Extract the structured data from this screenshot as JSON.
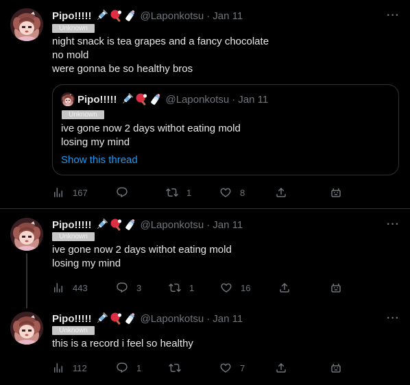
{
  "author": {
    "name": "Pipo!!!!!",
    "handle": "@Laponkotsu",
    "separator": "·",
    "badge": "Unknown",
    "emoji_names": [
      "syringe-emoji",
      "ping-pong-emoji",
      "baby-bottle-emoji"
    ]
  },
  "tweets": [
    {
      "date": "Jan 11",
      "lines": [
        "night snack is tea grapes and a fancy chocolate",
        "no mold",
        "were gonna be so healthy bros"
      ],
      "quote": {
        "name": "Pipo!!!!!",
        "handle": "@Laponkotsu",
        "date": "Jan 11",
        "badge": "Unknown",
        "lines": [
          "ive gone now 2 days withot eating mold",
          "losing my mind"
        ],
        "show_thread": "Show this thread"
      },
      "stats": {
        "views": "167",
        "replies": "",
        "retweets": "1",
        "likes": "8"
      }
    },
    {
      "date": "Jan 11",
      "lines": [
        "ive gone now 2 days withot eating mold",
        "losing my mind"
      ],
      "stats": {
        "views": "443",
        "replies": "3",
        "retweets": "1",
        "likes": "16"
      }
    },
    {
      "date": "Jan 11",
      "lines": [
        "this is a record i feel so healthy"
      ],
      "stats": {
        "views": "112",
        "replies": "1",
        "retweets": "",
        "likes": "7"
      }
    }
  ],
  "more_label": "···"
}
